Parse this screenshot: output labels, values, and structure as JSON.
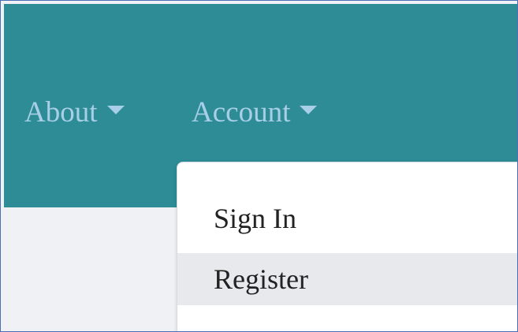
{
  "navbar": {
    "items": [
      {
        "label": "About"
      },
      {
        "label": "Account"
      }
    ]
  },
  "dropdown": {
    "items": [
      {
        "label": "Sign In"
      },
      {
        "label": "Register"
      }
    ]
  },
  "colors": {
    "navbar_bg": "#2d8c96",
    "nav_text": "#a8cfe7",
    "page_bg": "#eff1f5",
    "dropdown_bg": "#ffffff",
    "hover_bg": "#e7e9ec"
  }
}
